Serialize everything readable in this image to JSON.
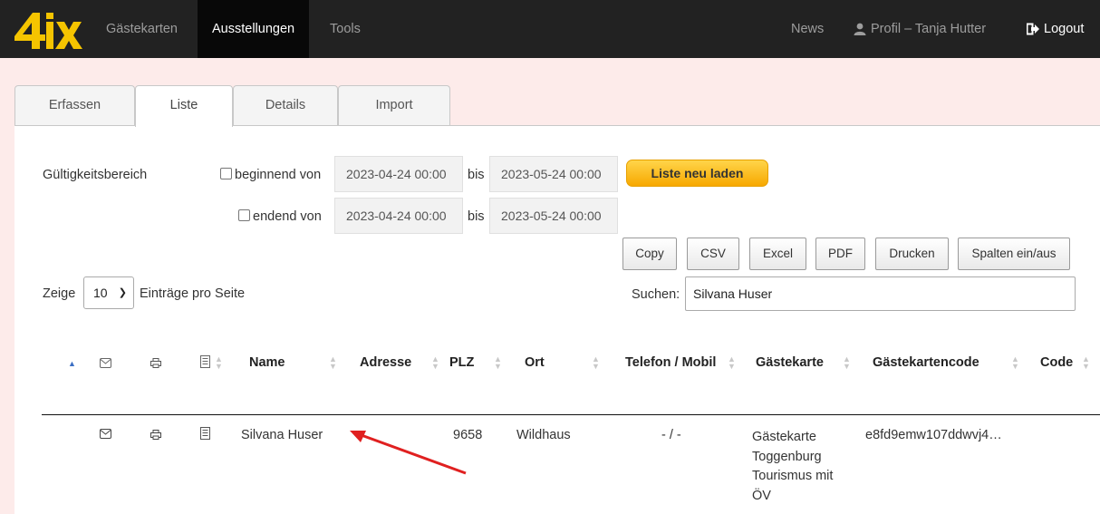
{
  "brand": {
    "logo_text": "4ix"
  },
  "nav": {
    "items": [
      "Gästekarten",
      "Ausstellungen",
      "Tools"
    ],
    "news": "News",
    "profile": "Profil – Tanja Hutter",
    "logout": "Logout"
  },
  "tabs": [
    "Erfassen",
    "Liste",
    "Details",
    "Import"
  ],
  "filter": {
    "label": "Gültigkeitsbereich",
    "begin_label": "beginnend von",
    "end_label": "endend von",
    "bis": "bis",
    "begin_from": "2023-04-24 00:00",
    "begin_to": "2023-05-24 00:00",
    "end_from": "2023-04-24 00:00",
    "end_to": "2023-05-24 00:00",
    "reload": "Liste neu laden"
  },
  "toolbar": [
    "Copy",
    "CSV",
    "Excel",
    "PDF",
    "Drucken",
    "Spalten ein/aus"
  ],
  "length": {
    "prefix": "Zeige",
    "value": "10",
    "suffix": "Einträge pro Seite"
  },
  "search": {
    "label": "Suchen:",
    "value": "Silvana Huser"
  },
  "columns": [
    "Name",
    "Adresse",
    "PLZ",
    "Ort",
    "Telefon / Mobil",
    "Gästekarte",
    "Gästekartencode",
    "Code"
  ],
  "rows": [
    {
      "name": "Silvana Huser",
      "adresse": "",
      "plz": "9658",
      "ort": "Wildhaus",
      "telefon": "- / -",
      "gaestekarte": "Gästekarte Toggenburg Tourismus mit ÖV",
      "code_gk": "e8fd9emw107ddwvj4…",
      "code": ""
    }
  ],
  "colors": {
    "navbar": "#222222",
    "accent": "#ffc107",
    "page_bg": "#fdebea",
    "annotation_arrow": "#e02020"
  }
}
